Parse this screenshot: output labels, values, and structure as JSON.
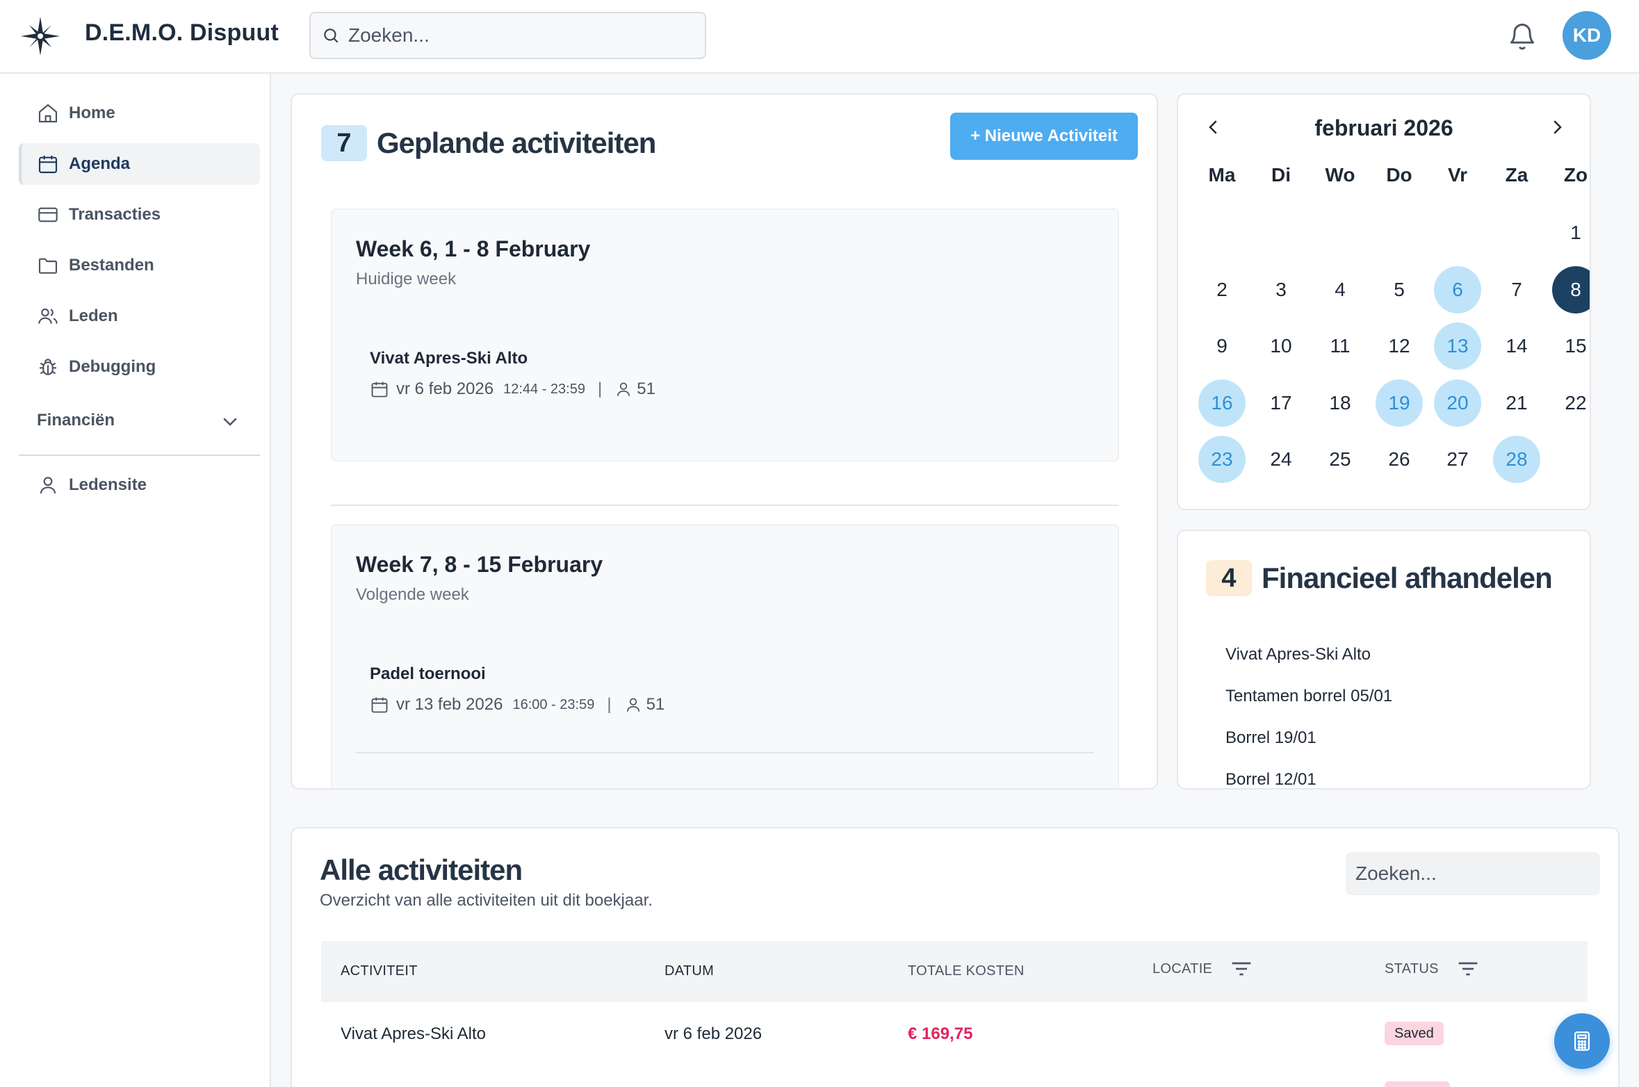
{
  "app": {
    "brand": "D.E.M.O. Dispuut"
  },
  "header": {
    "search_placeholder": "Zoeken...",
    "avatar_initials": "KD"
  },
  "sidebar": {
    "items": [
      {
        "label": "Home",
        "icon": "home-icon"
      },
      {
        "label": "Agenda",
        "icon": "calendar-icon",
        "active": true
      },
      {
        "label": "Transacties",
        "icon": "credit-card-icon"
      },
      {
        "label": "Bestanden",
        "icon": "folder-icon"
      },
      {
        "label": "Leden",
        "icon": "users-icon"
      },
      {
        "label": "Debugging",
        "icon": "bug-icon"
      }
    ],
    "group_label": "Financiën",
    "bottom_item": {
      "label": "Ledensite",
      "icon": "user-icon"
    }
  },
  "planned": {
    "count": "7",
    "title": "Geplande activiteiten",
    "new_button": "+ Nieuwe Activiteit",
    "weeks": [
      {
        "title": "Week 6, 1 - 8 February",
        "subtitle": "Huidige week",
        "activities": [
          {
            "name": "Vivat Apres-Ski Alto",
            "date": "vr 6 feb 2026",
            "time": "12:44 - 23:59",
            "sep": "|",
            "attendees": "51"
          }
        ]
      },
      {
        "title": "Week 7, 8 - 15 February",
        "subtitle": "Volgende week",
        "activities": [
          {
            "name": "Padel toernooi",
            "date": "vr 13 feb 2026",
            "time": "16:00 - 23:59",
            "sep": "|",
            "attendees": "51"
          }
        ]
      }
    ]
  },
  "calendar": {
    "month": "februari 2026",
    "weekdays": [
      "Ma",
      "Di",
      "Wo",
      "Do",
      "Vr",
      "Za",
      "Zo"
    ],
    "days": [
      "1",
      "2",
      "3",
      "4",
      "5",
      "6",
      "7",
      "8",
      "9",
      "10",
      "11",
      "12",
      "13",
      "14",
      "15",
      "16",
      "17",
      "18",
      "19",
      "20",
      "21",
      "22",
      "23",
      "24",
      "25",
      "26",
      "27",
      "28"
    ],
    "highlighted": [
      "6",
      "13",
      "16",
      "19",
      "20",
      "23",
      "28"
    ],
    "today": "8"
  },
  "financial": {
    "count": "4",
    "title": "Financieel afhandelen",
    "items": [
      "Vivat Apres-Ski Alto",
      "Tentamen borrel 05/01",
      "Borrel 19/01",
      "Borrel 12/01"
    ]
  },
  "all_activities": {
    "title": "Alle activiteiten",
    "subtitle": "Overzicht van alle activiteiten uit dit boekjaar.",
    "search_placeholder": "Zoeken...",
    "columns": [
      "ACTIVITEIT",
      "DATUM",
      "TOTALE KOSTEN",
      "LOCATIE",
      "STATUS"
    ],
    "rows": [
      {
        "activity": "Vivat Apres-Ski Alto",
        "date": "vr 6 feb 2026",
        "cost": "€ 169,75",
        "location": "",
        "status": "Saved"
      }
    ]
  },
  "colors": {
    "accent": "#4eacf0",
    "brand_dark": "#1d4163",
    "cost_red": "#e0245e",
    "highlight": "#bfe4fa"
  }
}
